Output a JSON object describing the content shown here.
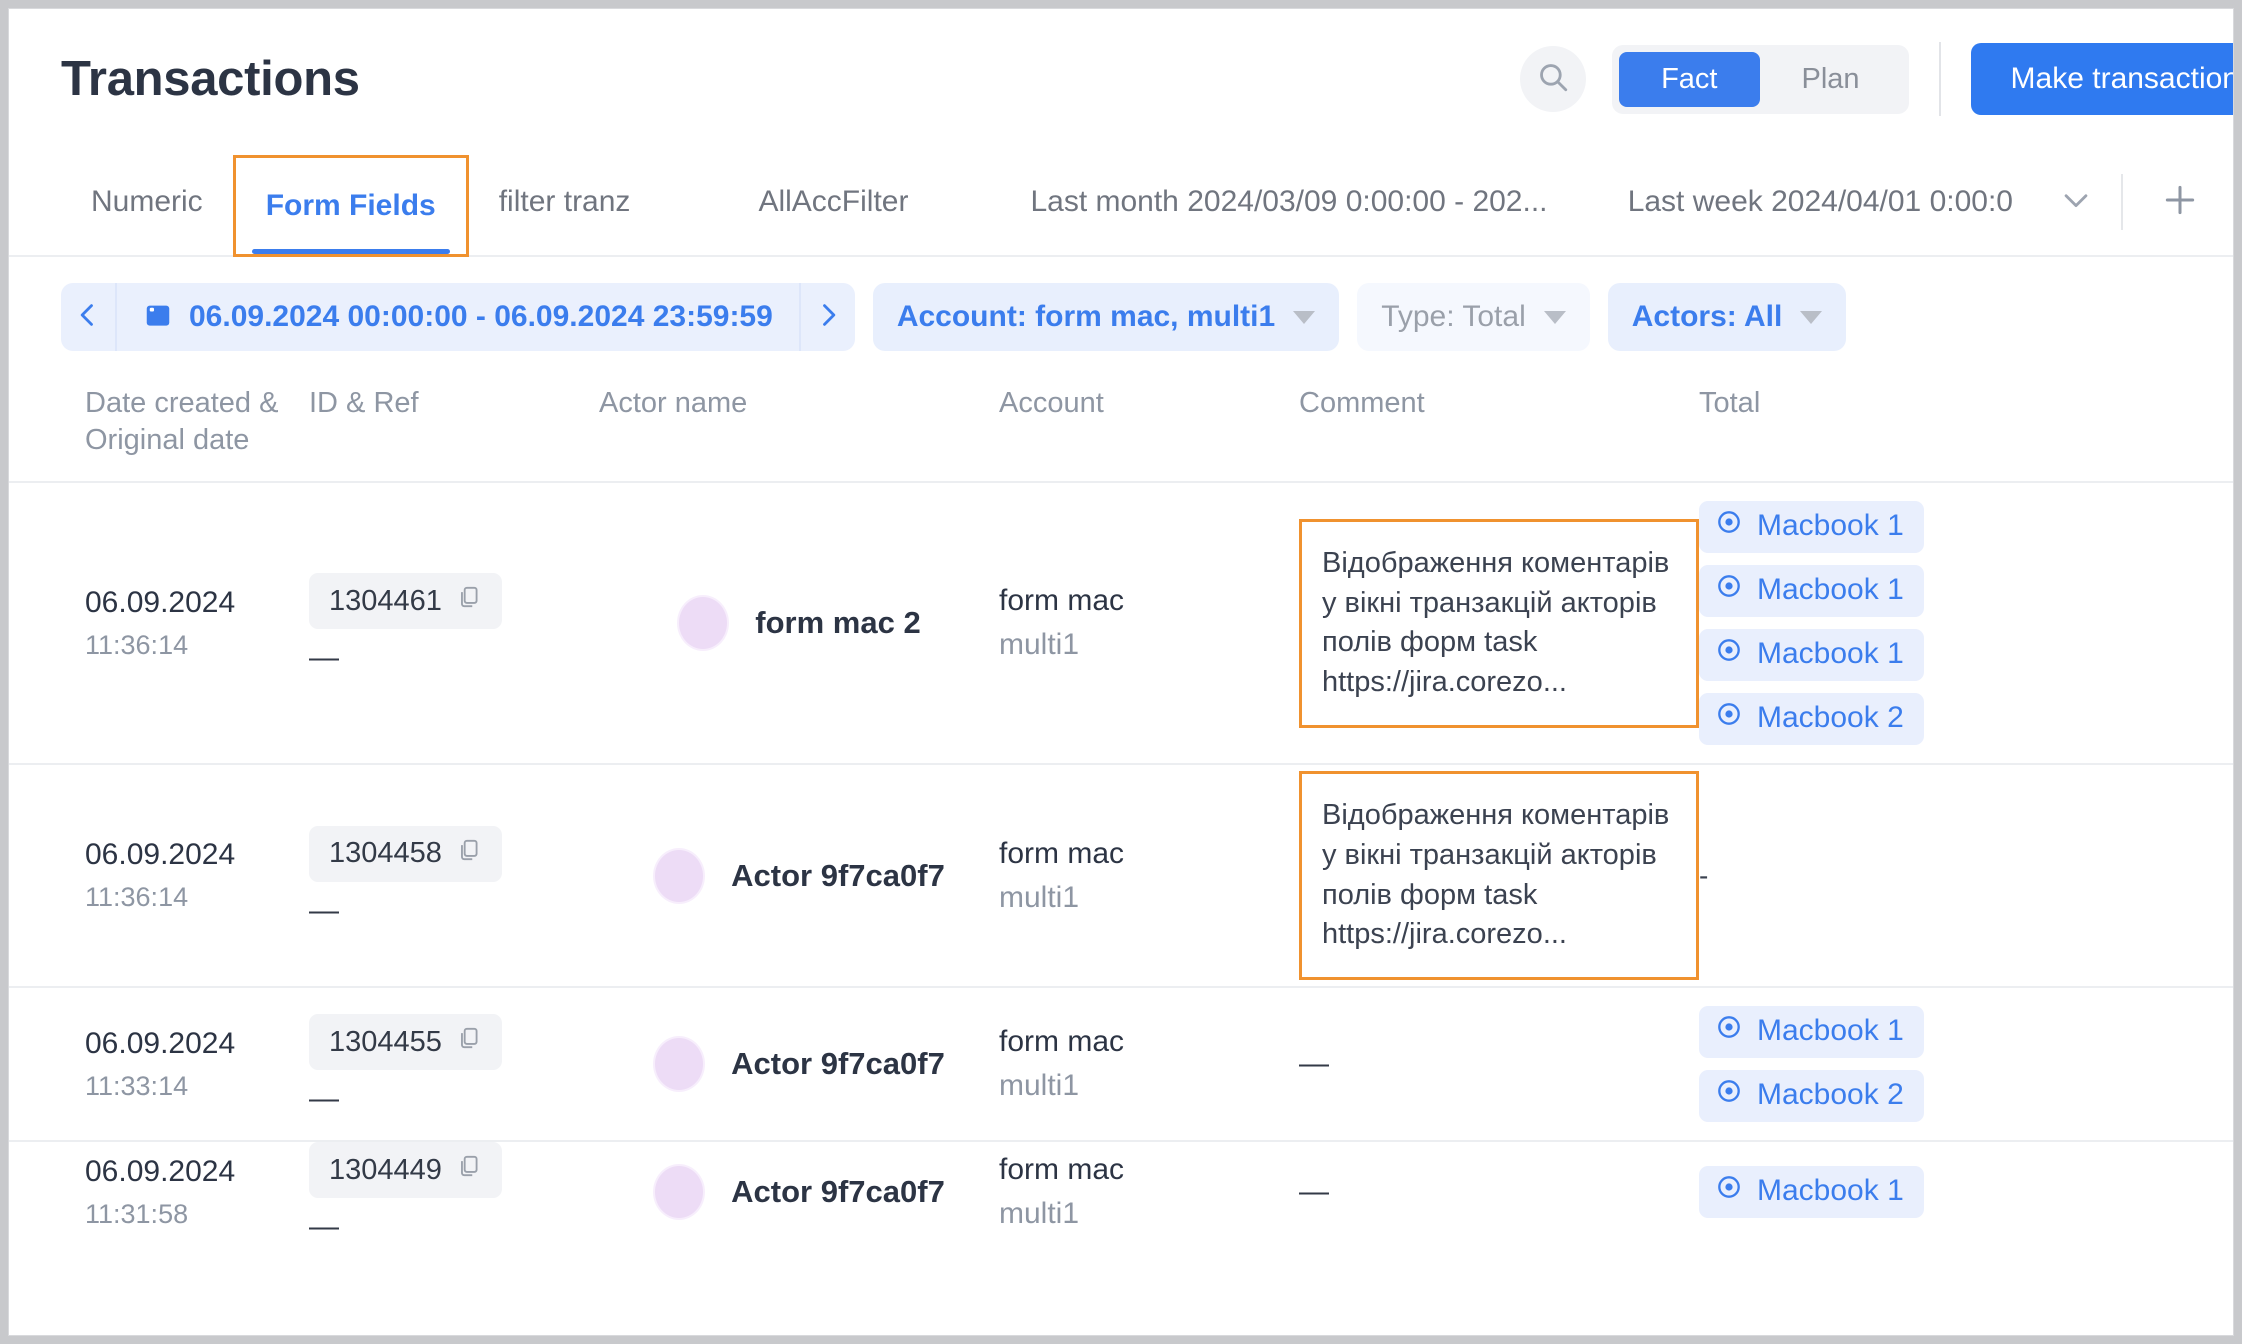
{
  "header": {
    "title": "Transactions",
    "search_icon": "search-icon",
    "toggle": {
      "options": [
        "Fact",
        "Plan"
      ],
      "selected": "Fact"
    },
    "primary_button": "Make transaction"
  },
  "tabs": {
    "items": [
      {
        "label": "Numeric",
        "active": false,
        "highlighted": false
      },
      {
        "label": "Form Fields",
        "active": true,
        "highlighted": true
      },
      {
        "label": "filter tranz",
        "active": false,
        "highlighted": false
      },
      {
        "label": "AllAccFilter",
        "active": false,
        "highlighted": false
      },
      {
        "label": "Last month 2024/03/09 0:00:00 - 202...",
        "active": false,
        "highlighted": false
      },
      {
        "label": "Last week 2024/04/01 0:00:0",
        "active": false,
        "highlighted": false
      }
    ],
    "chevron_icon": "chevron-down-icon",
    "add_icon": "plus-icon"
  },
  "filters": {
    "prev_icon": "chevron-left-icon",
    "next_icon": "chevron-right-icon",
    "calendar_icon": "calendar-icon",
    "date_range": "06.09.2024 00:00:00 - 06.09.2024 23:59:59",
    "account": "Account: form mac, multi1",
    "type": "Type: Total",
    "actors": "Actors: All"
  },
  "table": {
    "columns": [
      {
        "line1": "Date created &",
        "line2": "Original date"
      },
      {
        "line1": "ID & Ref",
        "line2": ""
      },
      {
        "line1": "Actor name",
        "line2": ""
      },
      {
        "line1": "Account",
        "line2": ""
      },
      {
        "line1": "Comment",
        "line2": ""
      },
      {
        "line1": "Total",
        "line2": ""
      }
    ],
    "rows": [
      {
        "date": "06.09.2024",
        "time": "11:36:14",
        "id": "1304461",
        "ref": "—",
        "actor": "form mac 2",
        "account": "form mac",
        "account_sub": "multi1",
        "comment": "Відображення коментарів у вікні транзакцій акторів полів форм task https://jira.corezo...",
        "comment_highlighted": true,
        "totals": [
          "Macbook 1",
          "Macbook 1",
          "Macbook 1",
          "Macbook 2"
        ],
        "total_empty": ""
      },
      {
        "date": "06.09.2024",
        "time": "11:36:14",
        "id": "1304458",
        "ref": "—",
        "actor": "Actor 9f7ca0f7",
        "account": "form mac",
        "account_sub": "multi1",
        "comment": "Відображення коментарів у вікні транзакцій акторів полів форм task https://jira.corezo...",
        "comment_highlighted": true,
        "totals": [],
        "total_empty": "-"
      },
      {
        "date": "06.09.2024",
        "time": "11:33:14",
        "id": "1304455",
        "ref": "—",
        "actor": "Actor 9f7ca0f7",
        "account": "form mac",
        "account_sub": "multi1",
        "comment": "—",
        "comment_highlighted": false,
        "totals": [
          "Macbook 1",
          "Macbook 2"
        ],
        "total_empty": ""
      },
      {
        "date": "06.09.2024",
        "time": "11:31:58",
        "id": "1304449",
        "ref": "—",
        "actor": "Actor 9f7ca0f7",
        "account": "form mac",
        "account_sub": "multi1",
        "comment": "—",
        "comment_highlighted": false,
        "totals": [
          "Macbook 1"
        ],
        "total_empty": ""
      }
    ]
  },
  "colors": {
    "accent_blue": "#3b7ded",
    "highlight_orange": "#f0922f",
    "badge_bg": "#e9effd",
    "avatar": "#eddcf6"
  }
}
